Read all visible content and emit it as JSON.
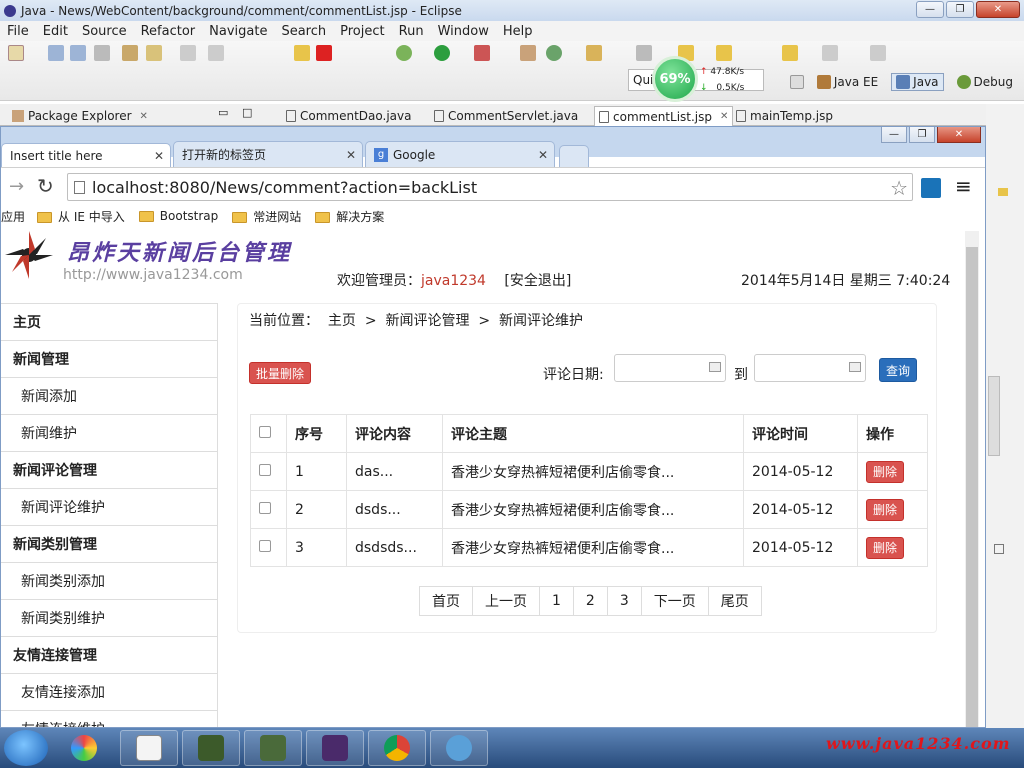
{
  "window": {
    "title": "Java - News/WebContent/background/comment/commentList.jsp - Eclipse"
  },
  "menu": [
    "File",
    "Edit",
    "Source",
    "Refactor",
    "Navigate",
    "Search",
    "Project",
    "Run",
    "Window",
    "Help"
  ],
  "quick_access": "Qui",
  "monitor": {
    "percent": "69%",
    "up": "47.8K/s",
    "down": "0.5K/s"
  },
  "perspectives": [
    "Java EE",
    "Java",
    "Debug"
  ],
  "view_tab": "Package Explorer",
  "editor_tabs": [
    "CommentDao.java",
    "CommentServlet.java",
    "commentList.jsp",
    "mainTemp.jsp"
  ],
  "browser": {
    "tabs": [
      "Insert title here",
      "打开新的标签页",
      "Google"
    ],
    "url": "localhost:8080/News/comment?action=backList",
    "bookmarks": [
      "应用",
      "从 IE 中导入",
      "Bootstrap",
      "常进网站",
      "解决方案"
    ]
  },
  "site": {
    "title": "昂炸天新闻后台管理",
    "url": "http://www.java1234.com",
    "welcome": "欢迎管理员：",
    "user": "java1234",
    "logout": "[安全退出]",
    "datetime": "2014年5月14日 星期三 7:40:24"
  },
  "sidebar": [
    {
      "label": "主页",
      "type": "h"
    },
    {
      "label": "新闻管理",
      "type": "h"
    },
    {
      "label": "新闻添加",
      "type": "c"
    },
    {
      "label": "新闻维护",
      "type": "c"
    },
    {
      "label": "新闻评论管理",
      "type": "h"
    },
    {
      "label": "新闻评论维护",
      "type": "c"
    },
    {
      "label": "新闻类别管理",
      "type": "h"
    },
    {
      "label": "新闻类别添加",
      "type": "c"
    },
    {
      "label": "新闻类别维护",
      "type": "c"
    },
    {
      "label": "友情连接管理",
      "type": "h"
    },
    {
      "label": "友情连接添加",
      "type": "c"
    },
    {
      "label": "友情连接维护",
      "type": "c"
    }
  ],
  "breadcrumb": {
    "prefix": "当前位置：",
    "home": "主页",
    "sep": ">",
    "level1": "新闻评论管理",
    "level2": "新闻评论维护"
  },
  "toolbar": {
    "batch_delete": "批量删除",
    "date_label": "评论日期:",
    "to": "到",
    "query": "查询"
  },
  "table": {
    "headers": [
      "序号",
      "评论内容",
      "评论主题",
      "评论时间",
      "操作"
    ],
    "rows": [
      {
        "id": "1",
        "content": "das...",
        "topic": "香港少女穿热裤短裙便利店偷零食...",
        "time": "2014-05-12",
        "action": "删除"
      },
      {
        "id": "2",
        "content": "dsds...",
        "topic": "香港少女穿热裤短裙便利店偷零食...",
        "time": "2014-05-12",
        "action": "删除"
      },
      {
        "id": "3",
        "content": "dsdsds...",
        "topic": "香港少女穿热裤短裙便利店偷零食...",
        "time": "2014-05-12",
        "action": "删除"
      }
    ]
  },
  "pager": [
    "首页",
    "上一页",
    "1",
    "2",
    "3",
    "下一页",
    "尾页"
  ],
  "watermark": "www.java1234.com"
}
